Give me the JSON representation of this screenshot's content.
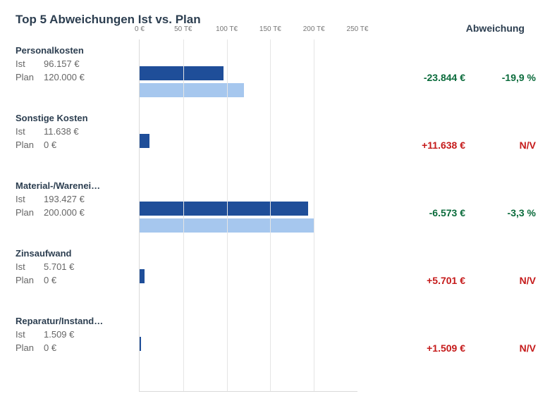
{
  "title": "Top 5 Abweichungen Ist vs. Plan",
  "dev_header": "Abweichung",
  "ist_key": "Ist",
  "plan_key": "Plan",
  "axis": {
    "max": 250,
    "unit_suffix": " T€",
    "zero_label": "0 €",
    "ticks": [
      0,
      50,
      100,
      150,
      200,
      250
    ]
  },
  "rows": [
    {
      "name": "Personalkosten",
      "ist_label": "96.157 €",
      "ist_value": 96157,
      "plan_label": "120.000 €",
      "plan_value": 120000,
      "dev_abs": "-23.844 €",
      "dev_pct": "-19,9 %",
      "dev_dir": "neg"
    },
    {
      "name": "Sonstige Kosten",
      "ist_label": "11.638 €",
      "ist_value": 11638,
      "plan_label": "0 €",
      "plan_value": 0,
      "dev_abs": "+11.638 €",
      "dev_pct": "N/V",
      "dev_dir": "pos"
    },
    {
      "name": "Material-/Warenei…",
      "ist_label": "193.427 €",
      "ist_value": 193427,
      "plan_label": "200.000 €",
      "plan_value": 200000,
      "dev_abs": "-6.573 €",
      "dev_pct": "-3,3 %",
      "dev_dir": "neg"
    },
    {
      "name": "Zinsaufwand",
      "ist_label": "5.701 €",
      "ist_value": 5701,
      "plan_label": "0 €",
      "plan_value": 0,
      "dev_abs": "+5.701 €",
      "dev_pct": "N/V",
      "dev_dir": "pos"
    },
    {
      "name": "Reparatur/Instand…",
      "ist_label": "1.509 €",
      "ist_value": 1509,
      "plan_label": "0 €",
      "plan_value": 0,
      "dev_abs": "+1.509 €",
      "dev_pct": "N/V",
      "dev_dir": "pos"
    }
  ],
  "chart_data": {
    "type": "bar",
    "orientation": "horizontal",
    "title": "Top 5 Abweichungen Ist vs. Plan",
    "xlabel": "",
    "ylabel": "",
    "xlim": [
      0,
      250000
    ],
    "x_ticks_eur": [
      0,
      50000,
      100000,
      150000,
      200000,
      250000
    ],
    "categories": [
      "Personalkosten",
      "Sonstige Kosten",
      "Material-/Wareneinsatz",
      "Zinsaufwand",
      "Reparatur/Instandhaltung"
    ],
    "series": [
      {
        "name": "Ist",
        "values": [
          96157,
          11638,
          193427,
          5701,
          1509
        ]
      },
      {
        "name": "Plan",
        "values": [
          120000,
          0,
          200000,
          0,
          0
        ]
      }
    ],
    "deviation_abs_eur": [
      -23844,
      11638,
      -6573,
      5701,
      1509
    ],
    "deviation_pct": [
      -19.9,
      null,
      -3.3,
      null,
      null
    ]
  }
}
